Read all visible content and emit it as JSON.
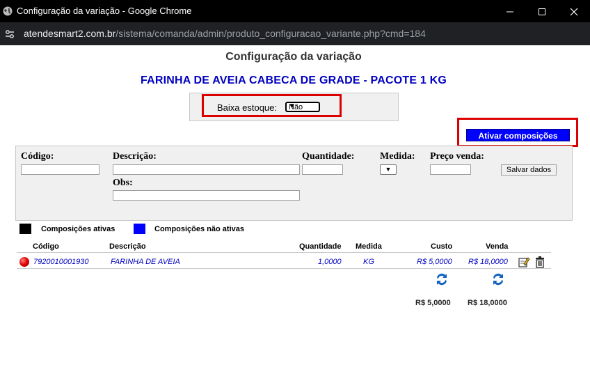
{
  "window": {
    "title": "Configuração da variação - Google Chrome",
    "url_host": "atendesmart2.com.br",
    "url_path": "/sistema/comanda/admin/produto_configuracao_variante.php?cmd=184"
  },
  "page": {
    "title": "Configuração da variação",
    "product_name": "FARINHA DE AVEIA CABECA DE GRADE - PACOTE 1 KG"
  },
  "estoque": {
    "label": "Baixa estoque:",
    "selected": "Não"
  },
  "ativar_button": "Ativar composições",
  "form": {
    "codigo_label": "Código:",
    "descricao_label": "Descrição:",
    "quantidade_label": "Quantidade:",
    "medida_label": "Medida:",
    "preco_label": "Preço venda:",
    "obs_label": "Obs:",
    "salvar_label": "Salvar dados"
  },
  "legend": {
    "active_label": "Composições ativas",
    "active_color": "#000000",
    "inactive_label": "Composições não ativas",
    "inactive_color": "#0000ff"
  },
  "table": {
    "headers": {
      "codigo": "Código",
      "descricao": "Descrição",
      "quantidade": "Quantidade",
      "medida": "Medida",
      "custo": "Custo",
      "venda": "Venda"
    },
    "rows": [
      {
        "status_icon": "red-dot-icon",
        "codigo": "7920010001930",
        "descricao": "FARINHA DE AVEIA",
        "quantidade": "1,0000",
        "medida": "KG",
        "custo": "R$ 5,0000",
        "venda": "R$ 18,0000"
      }
    ],
    "totals": {
      "custo": "R$ 5,0000",
      "venda": "R$ 18,0000"
    }
  },
  "colors": {
    "accent_blue": "#0000c0",
    "highlight_red": "#dd0000"
  }
}
